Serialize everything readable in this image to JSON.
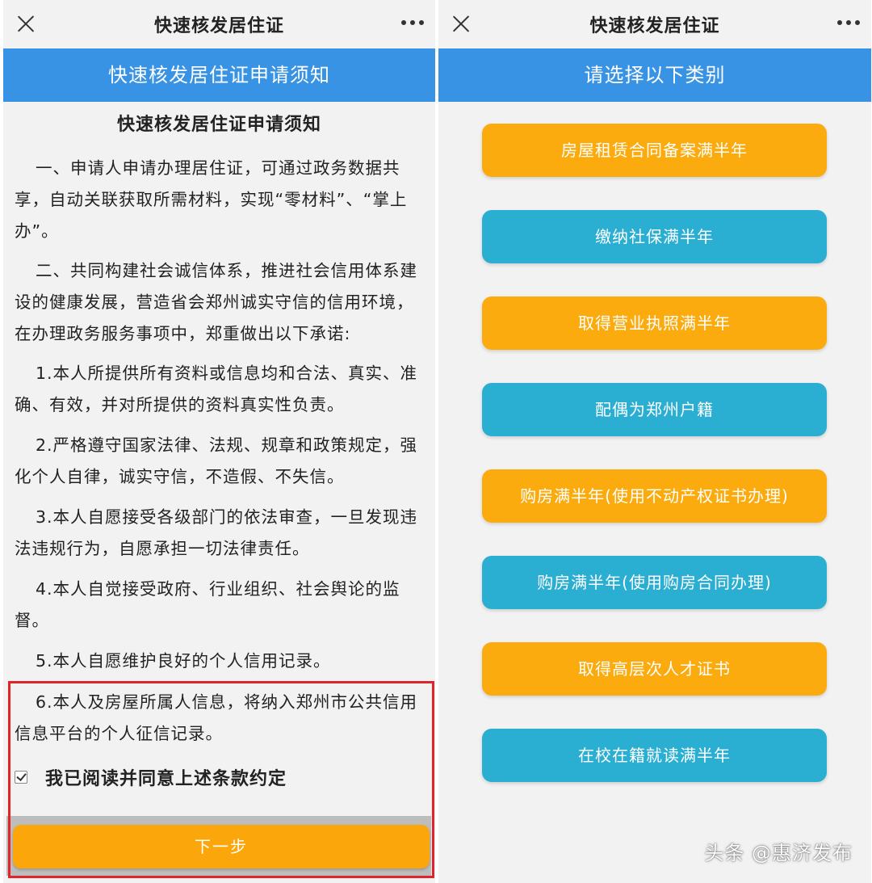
{
  "left": {
    "topbar_title": "快速核发居住证",
    "header": "快速核发居住证申请须知",
    "doc_title": "快速核发居住证申请须知",
    "paragraphs": [
      "一、申请人申请办理居住证，可通过政务数据共享，自动关联获取所需材料，实现“零材料”、“掌上办”。",
      "二、共同构建社会诚信体系，推进社会信用体系建设的健康发展，营造省会郑州诚实守信的信用环境，在办理政务服务事项中，郑重做出以下承诺:",
      "1.本人所提供所有资料或信息均和合法、真实、准确、有效，并对所提供的资料真实性负责。",
      "2.严格遵守国家法律、法规、规章和政策规定，强化个人自律，诚实守信，不造假、不失信。",
      "3.本人自愿接受各级部门的依法审查，一旦发现违法违规行为，自愿承担一切法律责任。",
      "4.本人自觉接受政府、行业组织、社会舆论的监督。",
      "5.本人自愿维护良好的个人信用记录。",
      "6.本人及房屋所属人信息，将纳入郑州市公共信用信息平台的个人征信记录。"
    ],
    "agree_label": "我已阅读并同意上述条款约定",
    "agree_checked": true,
    "next_button": "下一步"
  },
  "right": {
    "topbar_title": "快速核发居住证",
    "header": "请选择以下类别",
    "options": [
      {
        "label": "房屋租赁合同备案满半年",
        "color": "orange"
      },
      {
        "label": "缴纳社保满半年",
        "color": "teal"
      },
      {
        "label": "取得营业执照满半年",
        "color": "orange"
      },
      {
        "label": "配偶为郑州户籍",
        "color": "teal"
      },
      {
        "label": "购房满半年(使用不动产权证书办理)",
        "color": "orange"
      },
      {
        "label": "购房满半年(使用购房合同办理)",
        "color": "teal"
      },
      {
        "label": "取得高层次人才证书",
        "color": "orange"
      },
      {
        "label": "在校在籍就读满半年",
        "color": "teal"
      }
    ]
  },
  "watermark": "头条 @惠济发布",
  "colors": {
    "header_blue": "#3993e5",
    "orange": "#fbab0e",
    "teal": "#2aaed2",
    "highlight_red": "#e0242a"
  },
  "icons": [
    "close-icon",
    "more-icon",
    "checkbox-checked-icon"
  ]
}
